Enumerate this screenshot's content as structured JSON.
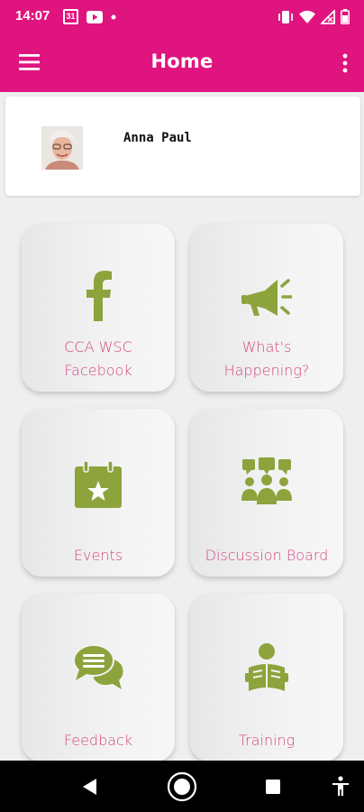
{
  "status": {
    "time": "14:07",
    "calendar_day": "31"
  },
  "appbar": {
    "title": "Home"
  },
  "profile": {
    "name": "Anna Paul"
  },
  "tiles": [
    {
      "line1": "CCA WSC",
      "line2": "Facebook",
      "icon": "facebook-icon"
    },
    {
      "line1": "What's",
      "line2": "Happening?",
      "icon": "megaphone-icon"
    },
    {
      "line1": "",
      "line2": "Events",
      "icon": "calendar-star-icon"
    },
    {
      "line1": "",
      "line2": "Discussion Board",
      "icon": "discussion-group-icon"
    },
    {
      "line1": "",
      "line2": "Feedback",
      "icon": "chat-bubbles-icon"
    },
    {
      "line1": "",
      "line2": "Training",
      "icon": "reading-person-icon"
    }
  ],
  "colors": {
    "brand": "#e0147f",
    "icon_green": "#8da33c",
    "label_pink": "#d6467f"
  }
}
